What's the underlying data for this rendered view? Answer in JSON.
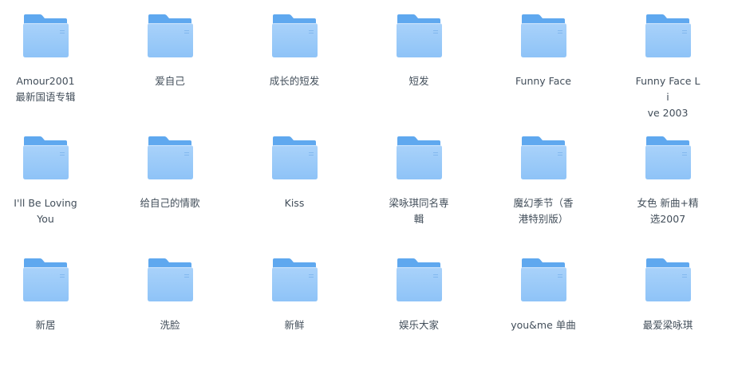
{
  "folders": [
    {
      "name": "Amour2001\n最新国语专辑",
      "lines": [
        "Amour2001",
        "最新国语专辑"
      ]
    },
    {
      "name": "爱自己",
      "lines": [
        "爱自己"
      ]
    },
    {
      "name": "成长的短发",
      "lines": [
        "成长的短发"
      ]
    },
    {
      "name": "短发",
      "lines": [
        "短发"
      ]
    },
    {
      "name": "Funny Face",
      "lines": [
        "Funny Face"
      ]
    },
    {
      "name": "Funny Face Live 2003",
      "lines": [
        "Funny Face Li",
        "ve 2003"
      ]
    },
    {
      "name": "I'll Be Loving You",
      "lines": [
        "I'll Be Loving",
        "You"
      ]
    },
    {
      "name": "给自己的情歌",
      "lines": [
        "给自己的情歌"
      ]
    },
    {
      "name": "Kiss",
      "lines": [
        "Kiss"
      ]
    },
    {
      "name": "梁咏琪同名専辑",
      "lines": [
        "梁咏琪同名専",
        "輯"
      ]
    },
    {
      "name": "魔幻季节（香港特别版）",
      "lines": [
        "魔幻季节（香",
        "港特别版）"
      ]
    },
    {
      "name": "女色 新曲+精选2007",
      "lines": [
        "女色 新曲+精",
        "选2007"
      ]
    },
    {
      "name": "新居",
      "lines": [
        "新居"
      ]
    },
    {
      "name": "洗脸",
      "lines": [
        "洗脸"
      ]
    },
    {
      "name": "新鲜",
      "lines": [
        "新鲜"
      ]
    },
    {
      "name": "娱乐大家",
      "lines": [
        "娱乐大家"
      ]
    },
    {
      "name": "you&me 单曲",
      "lines": [
        "you&me 单曲"
      ]
    },
    {
      "name": "最爱梁咏琪",
      "lines": [
        "最爱梁咏琪"
      ]
    }
  ],
  "icon": "folder-icon",
  "colors": {
    "folder_back": "#5fa8ef",
    "folder_front_top": "#a9d2fa",
    "folder_front_bottom": "#8ec3f7",
    "label_text": "#424e5a"
  }
}
